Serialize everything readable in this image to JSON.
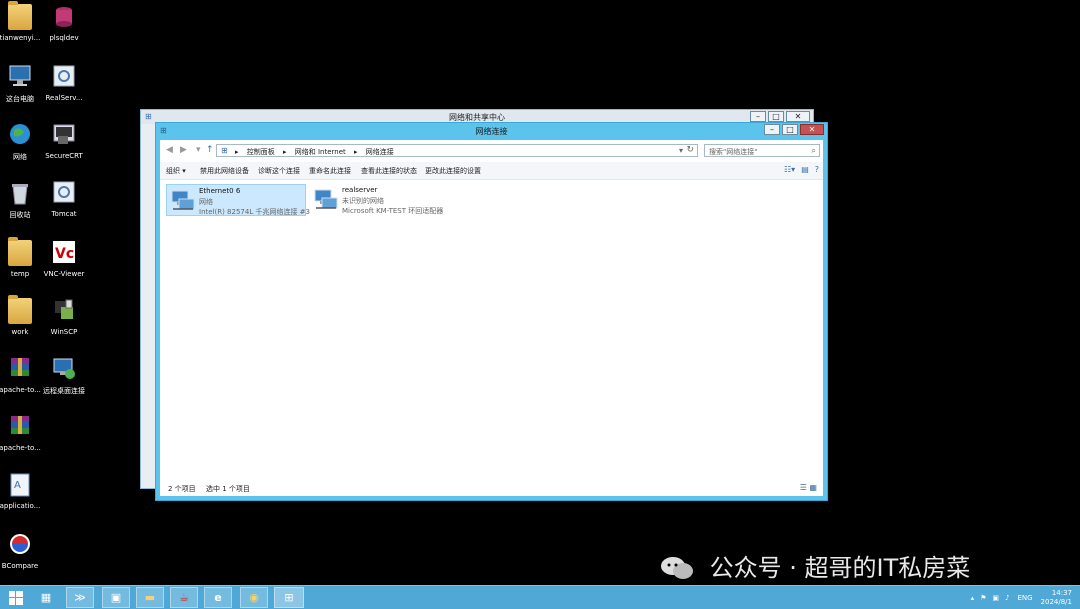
{
  "desktop": {
    "icons": [
      {
        "label": "tianwenyi...",
        "icon": "folder-icon"
      },
      {
        "label": "plsqldev",
        "icon": "plsqldev-icon"
      },
      {
        "label": "这台电脑",
        "icon": "computer-icon"
      },
      {
        "label": "RealServ...",
        "icon": "realserver-icon"
      },
      {
        "label": "网络",
        "icon": "network-globe-icon"
      },
      {
        "label": "SecureCRT",
        "icon": "securecrt-icon"
      },
      {
        "label": "回收站",
        "icon": "recycle-bin-icon"
      },
      {
        "label": "Tomcat",
        "icon": "tomcat-icon"
      },
      {
        "label": "temp",
        "icon": "folder-icon"
      },
      {
        "label": "VNC-Viewer",
        "icon": "vnc-icon"
      },
      {
        "label": "work",
        "icon": "folder-icon"
      },
      {
        "label": "WinSCP",
        "icon": "winscp-icon"
      },
      {
        "label": "apache-to...",
        "icon": "winrar-icon"
      },
      {
        "label": "远程桌面连接",
        "icon": "remote-desktop-icon"
      },
      {
        "label": "apache-to...",
        "icon": "winrar-icon"
      },
      {
        "label": "applicatio...",
        "icon": "document-icon"
      },
      {
        "label": "BCompare",
        "icon": "bcompare-icon"
      }
    ]
  },
  "back_window": {
    "title": "网络和共享中心"
  },
  "front_window": {
    "title": "网络连接",
    "breadcrumb": [
      "控制面板",
      "网络和 Internet",
      "网络连接"
    ],
    "search_placeholder": "搜索\"网络连接\"",
    "commands": [
      "组织 ▾",
      "禁用此网络设备",
      "诊断这个连接",
      "重命名此连接",
      "查看此连接的状态",
      "更改此连接的设置"
    ],
    "connections": [
      {
        "name": "Ethernet0 6",
        "status": "网络",
        "device": "Intel(R) 82574L 千兆网络连接 #3"
      },
      {
        "name": "realserver",
        "status": "未识别的网络",
        "device": "Microsoft KM-TEST 环回适配器"
      }
    ],
    "status_count": "2 个项目",
    "status_selected": "选中 1 个项目"
  },
  "taskbar": {
    "lang": "ENG",
    "time": "14:37",
    "date": "2024/8/1"
  },
  "watermark": {
    "text": "公众号 · 超哥的IT私房菜"
  },
  "colors": {
    "taskbar": "#4fa8d6",
    "titlebar_active": "#5bc3ec",
    "selection": "#cce8ff"
  }
}
